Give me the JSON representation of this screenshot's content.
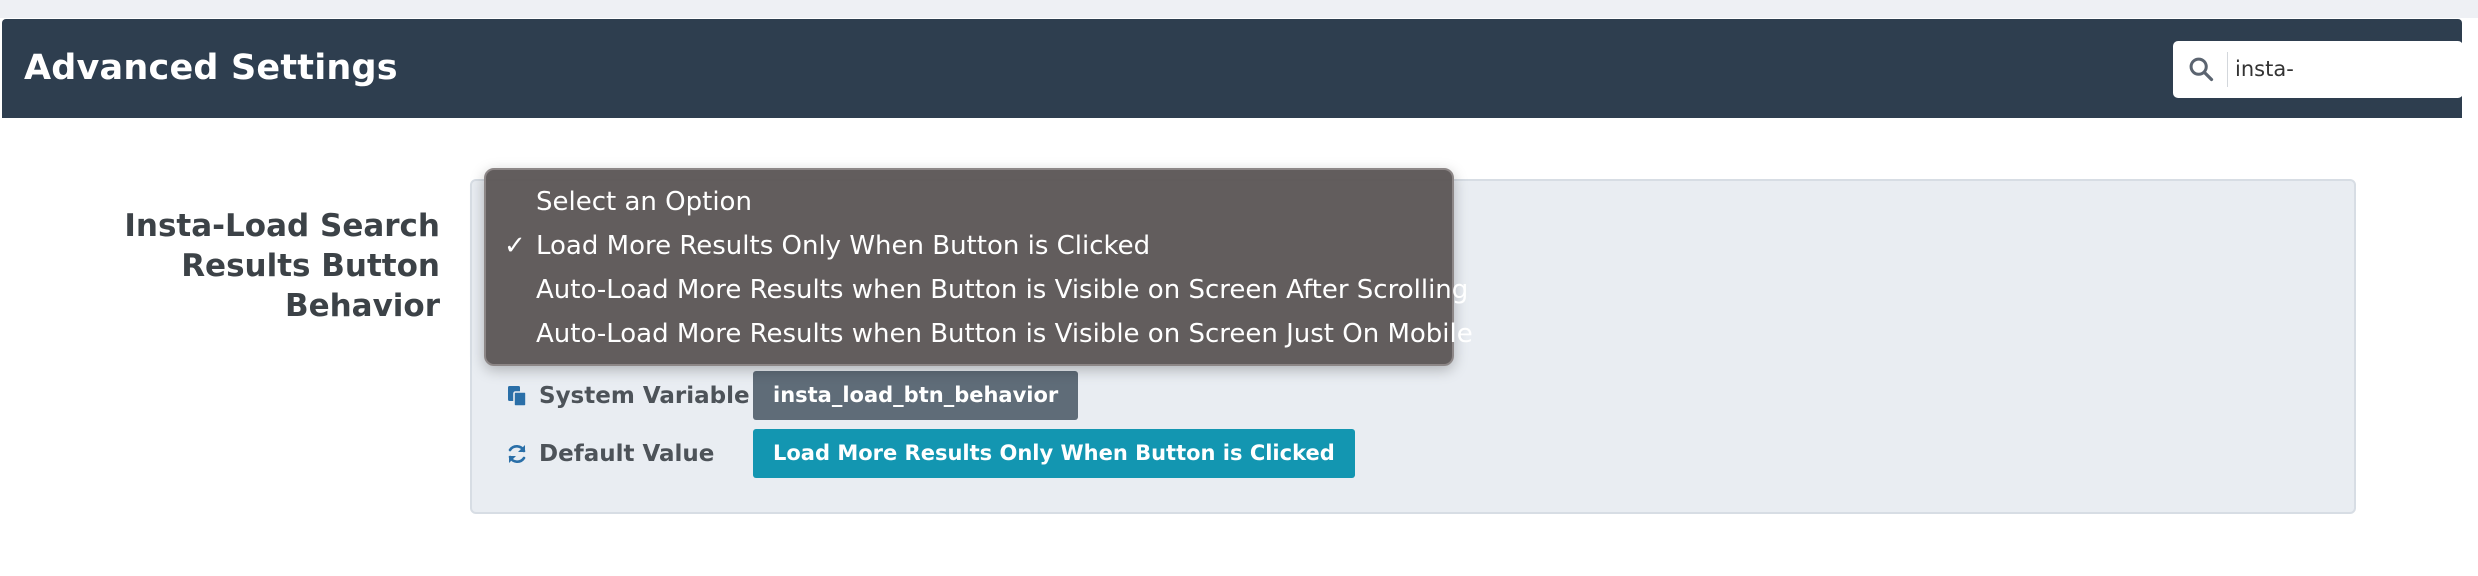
{
  "header": {
    "title": "Advanced Settings"
  },
  "search": {
    "value": "insta-",
    "icon": "search-icon"
  },
  "setting": {
    "label": "Insta-Load Search Results Button Behavior",
    "dropdown": {
      "options": [
        "Select an Option",
        "Load More Results Only When Button is Clicked",
        "Auto-Load More Results when Button is Visible on Screen After Scrolling",
        "Auto-Load More Results when Button is Visible on Screen Just On Mobile"
      ],
      "selected_index": 1,
      "check_mark": "✓"
    },
    "system_variable": {
      "label": "System Variable",
      "value": "insta_load_btn_behavior"
    },
    "default_value": {
      "label": "Default Value",
      "value": "Load More Results Only When Button is Clicked"
    }
  },
  "colors": {
    "header_bg": "#2e3e4f",
    "default_chip": "#1396b1",
    "variable_chip": "#5f6c78"
  }
}
